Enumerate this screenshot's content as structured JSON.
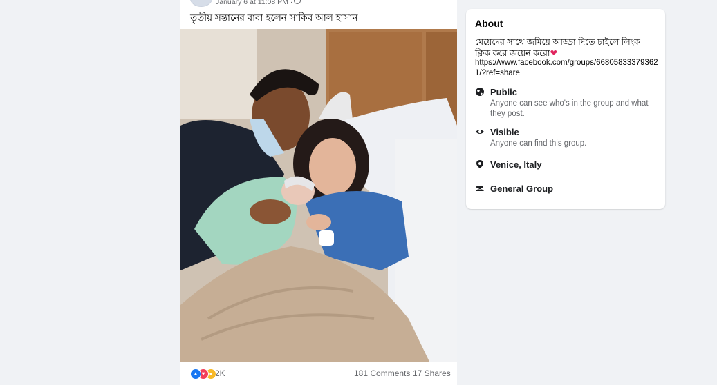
{
  "post": {
    "time": "January 6 at 11:08 PM ·",
    "text": "তৃতীয় সন্তানের বাবা হলেন সাকিব আল হাসান",
    "reaction_count": "2K",
    "comments": "181 Comments",
    "shares": "17 Shares"
  },
  "about": {
    "title": "About",
    "description": "মেয়েদের সাথে জমিয়ে আড্ডা দিতে চাইলে লিংক ক্লিক করে জয়েন করো",
    "link": "https://www.facebook.com/groups/668058333793621/?ref=share",
    "public_title": "Public",
    "public_sub": "Anyone can see who's in the group and what they post.",
    "visible_title": "Visible",
    "visible_sub": "Anyone can find this group.",
    "location": "Venice, Italy",
    "group_type": "General Group"
  },
  "colors": {
    "background": "#f0f2f5",
    "card": "#ffffff",
    "secondary_text": "#65676b",
    "like": "#1877f2",
    "love": "#f33e58",
    "care": "#f7b928"
  }
}
